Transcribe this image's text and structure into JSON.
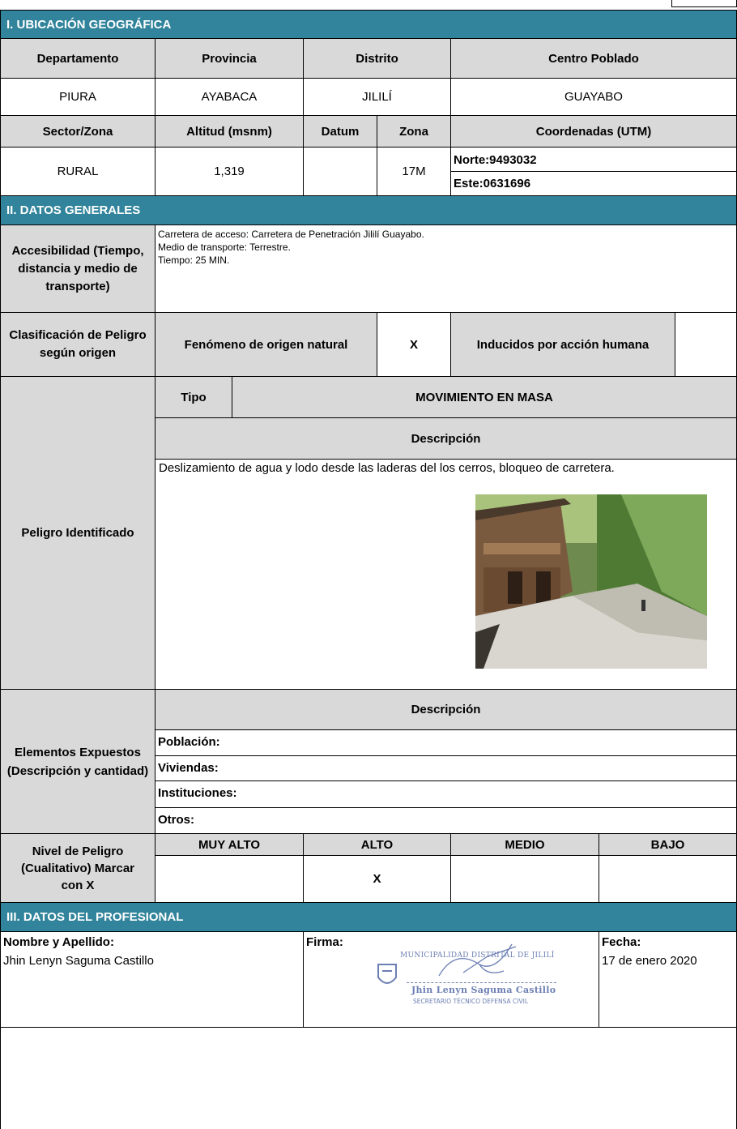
{
  "sections": {
    "s1": "I. UBICACIÓN GEOGRÁFICA",
    "s2": "II. DATOS GENERALES",
    "s3": "III. DATOS DEL PROFESIONAL"
  },
  "ubicacion": {
    "h_departamento": "Departamento",
    "h_provincia": "Provincia",
    "h_distrito": "Distrito",
    "h_centro_poblado": "Centro Poblado",
    "departamento": "PIURA",
    "provincia": "AYABACA",
    "distrito": "JILILÍ",
    "centro_poblado": "GUAYABO",
    "h_sector": "Sector/Zona",
    "h_altitud": "Altitud (msnm)",
    "h_datum": "Datum",
    "h_zona": "Zona",
    "h_coordenadas": "Coordenadas (UTM)",
    "sector": "RURAL",
    "altitud": "1,319",
    "datum": "",
    "zona": "17M",
    "norte": "Norte:9493032",
    "este": "Este:0631696"
  },
  "generales": {
    "accesibilidad_label": "Accesibilidad (Tiempo, distancia y medio de transporte)",
    "acceso": "Carretera de acceso: Carretera de Penetración Jililí Guayabo.",
    "medio": "Medio de transporte: Terrestre.",
    "tiempo": "Tiempo: 25 MIN.",
    "clasificacion_label": "Clasificación de Peligro según origen",
    "fenomeno_natural": "Fenómeno de origen natural",
    "fenomeno_natural_mark": "X",
    "inducidos": "Inducidos por acción humana",
    "inducidos_mark": "",
    "peligro_label": "Peligro Identificado",
    "tipo_label": "Tipo",
    "tipo_value": "MOVIMIENTO EN MASA",
    "descripcion_label": "Descripción",
    "descripcion_text": "Deslizamiento de agua y lodo desde las laderas del los cerros, bloqueo de carretera.",
    "elementos_label": "Elementos Expuestos (Descripción y cantidad)",
    "elementos_desc_label": "Descripción",
    "poblacion": "Población:",
    "viviendas": "Viviendas:",
    "instituciones": "Instituciones:",
    "otros": "Otros:",
    "nivel_label": "Nivel de Peligro (Cualitativo) Marcar con X",
    "niveles": [
      "MUY ALTO",
      "ALTO",
      "MEDIO",
      "BAJO"
    ],
    "marcas": [
      "",
      "X",
      "",
      ""
    ]
  },
  "profesional": {
    "nombre_label": "Nombre y Apellido:",
    "nombre": "Jhin Lenyn Saguma Castillo",
    "firma_label": "Firma:",
    "fecha_label": "Fecha:",
    "fecha": "17 de enero 2020",
    "stamp_line1": "MUNICIPALIDAD DISTRITAL DE JILILÍ",
    "stamp_line2": "Jhin Lenyn Saguma Castillo",
    "stamp_line3": "SECRETARIO TÉCNICO DEFENSA CIVIL"
  },
  "colors": {
    "header": "#31849b",
    "gray": "#d9d9d9",
    "stamp": "#6c7fb3"
  },
  "icons": {
    "photo": "landslide-road-photo",
    "seal": "municipal-seal-icon"
  }
}
